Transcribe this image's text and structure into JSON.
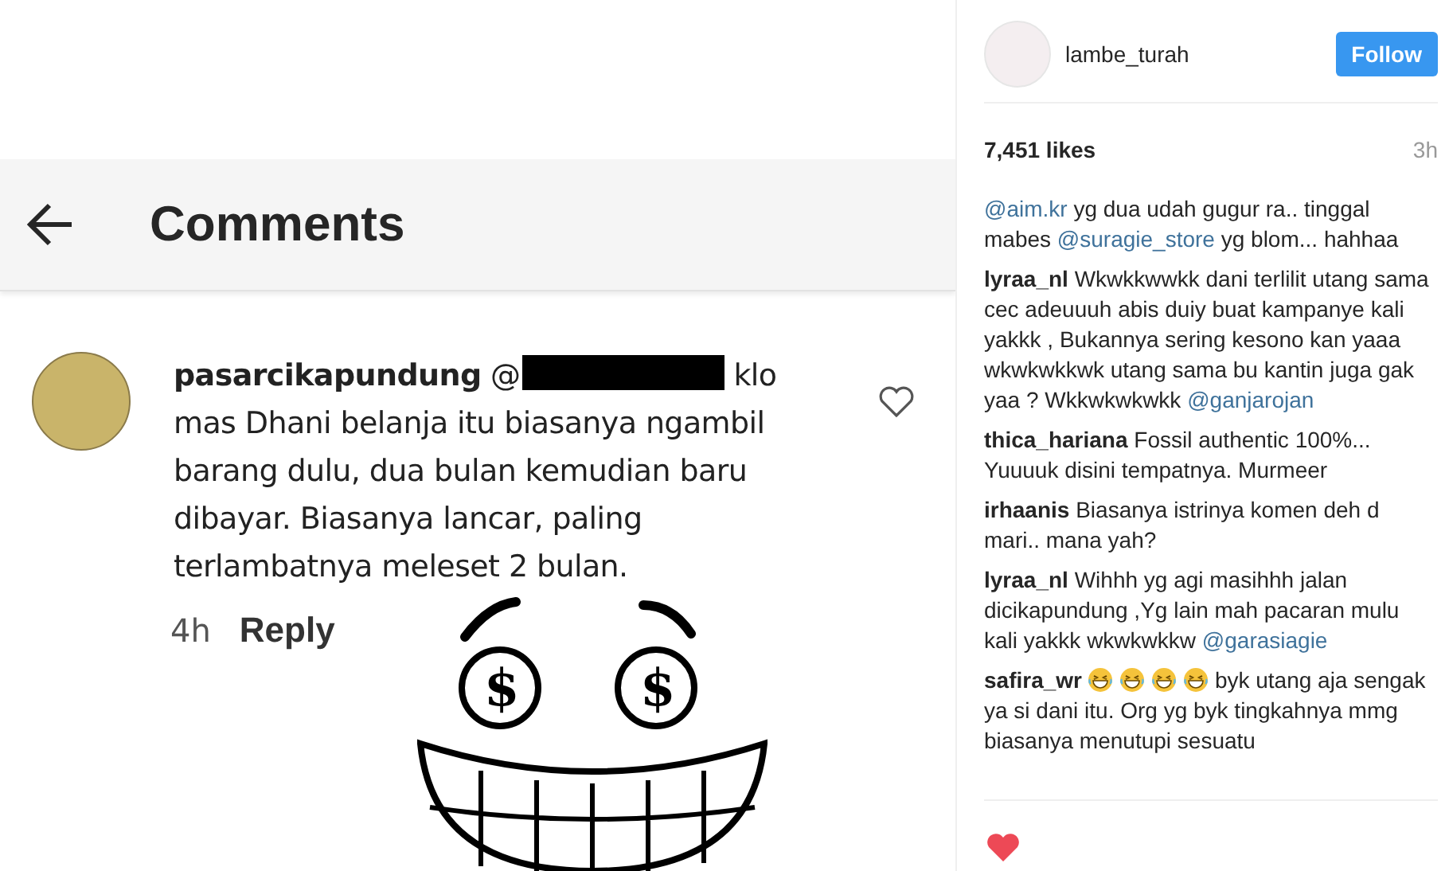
{
  "post_image": {
    "header_title": "Comments",
    "comment": {
      "username": "pasarcikapundung",
      "mention_prefix": "@",
      "text": "klo mas Dhani belanja itu biasanya ngambil barang dulu, dua bulan kemudian baru dibayar. Biasanya lancar, paling terlambatnya meleset 2 bulan.",
      "time": "4h",
      "reply": "Reply"
    },
    "sticker": {
      "eye_symbols": [
        "$",
        "$"
      ]
    }
  },
  "author": {
    "username": "lambe_turah",
    "follow": "Follow"
  },
  "likes": "7,451 likes",
  "time": "3h",
  "comments": [
    {
      "parts": [
        {
          "kind": "mention",
          "text": "@aim.kr"
        },
        {
          "kind": "text",
          "text": "yg dua udah gugur ra.. tinggal mabes"
        },
        {
          "kind": "mention",
          "text": "@suragie_store"
        },
        {
          "kind": "text",
          "text": "yg blom... hahhaa"
        }
      ]
    },
    {
      "parts": [
        {
          "kind": "user",
          "text": "lyraa_nl"
        },
        {
          "kind": "text",
          "text": "Wkwkkwwkk dani terlilit utang sama cec adeuuuh abis duiy buat kampanye kali yakkk , Bukannya sering kesono kan yaaa wkwkwkkwk utang sama bu kantin juga gak yaa ? Wkkwkwkwkk"
        },
        {
          "kind": "mention",
          "text": "@ganjarojan"
        }
      ]
    },
    {
      "parts": [
        {
          "kind": "user",
          "text": "thica_hariana"
        },
        {
          "kind": "text",
          "text": "Fossil authentic 100%... Yuuuuk disini tempatnya. Murmeer"
        }
      ]
    },
    {
      "parts": [
        {
          "kind": "user",
          "text": "irhaanis"
        },
        {
          "kind": "text",
          "text": "Biasanya istrinya komen deh d mari.. mana yah?"
        }
      ]
    },
    {
      "parts": [
        {
          "kind": "user",
          "text": "lyraa_nl"
        },
        {
          "kind": "text",
          "text": "Wihhh yg agi masihhh jalan dicikapundung ,Yg lain mah pacaran mulu kali yakkk wkwkwkkw"
        },
        {
          "kind": "mention",
          "text": "@garasiagie"
        }
      ]
    },
    {
      "parts": [
        {
          "kind": "user",
          "text": "safira_wr"
        },
        {
          "kind": "emoji"
        },
        {
          "kind": "emoji"
        },
        {
          "kind": "emoji"
        },
        {
          "kind": "emoji"
        },
        {
          "kind": "text",
          "text": "byk utang aja sengak ya si dani itu. Org yg byk tingkahnya mmg biasanya menutupi sesuatu"
        }
      ]
    }
  ]
}
